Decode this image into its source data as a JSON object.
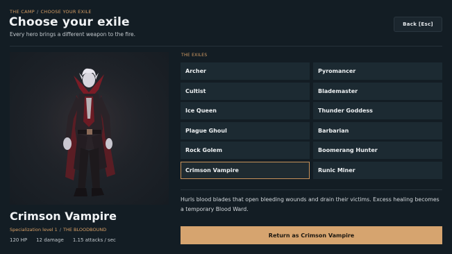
{
  "breadcrumb": {
    "root": "THE CAMP",
    "current": "CHOOSE YOUR EXILE"
  },
  "header": {
    "title": "Choose your exile",
    "subtitle": "Every hero brings a different weapon to the fire.",
    "back_label": "Back  [Esc]"
  },
  "selected_hero": {
    "name": "Crimson Vampire",
    "specialization": "Specialization level 1",
    "subclass": "THE BLOODBOUND",
    "stats": {
      "hp": "120 HP",
      "damage": "12 damage",
      "attack_speed": "1.15 attacks / sec"
    },
    "description": "Hurls blood blades that open bleeding wounds and drain their victims. Excess healing becomes a temporary Blood Ward.",
    "return_label": "Return as Crimson Vampire"
  },
  "exiles": {
    "label": "THE EXILES",
    "items": [
      {
        "name": "Archer"
      },
      {
        "name": "Pyromancer"
      },
      {
        "name": "Cultist"
      },
      {
        "name": "Blademaster"
      },
      {
        "name": "Ice Queen"
      },
      {
        "name": "Thunder Goddess"
      },
      {
        "name": "Plague Ghoul"
      },
      {
        "name": "Barbarian"
      },
      {
        "name": "Rock Golem"
      },
      {
        "name": "Boomerang Hunter"
      },
      {
        "name": "Crimson Vampire",
        "selected": true
      },
      {
        "name": "Runic Miner"
      }
    ]
  },
  "colors": {
    "background": "#131d24",
    "accent": "#d9a066",
    "button": "#1c2a32",
    "primary_button": "#d6a46f"
  }
}
